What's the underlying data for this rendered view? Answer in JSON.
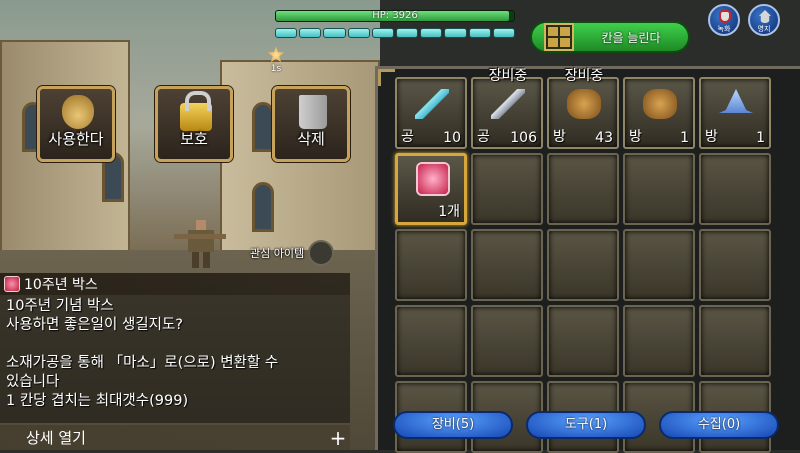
{
  "hud": {
    "hp_text": "HP: 3926",
    "hp_fraction": 0.98,
    "mp_segments": 10,
    "buff_time": "1s",
    "expand_label": "칸을 늘린다",
    "record_label": "녹화",
    "home_label": "영지"
  },
  "actions": {
    "use": "사용한다",
    "lock": "보호",
    "delete": "삭제"
  },
  "favorite_label": "관심 아이템",
  "description": {
    "title": "10주년 박스",
    "lines": [
      "10주년 기념 박스",
      "사용하면 좋은일이 생길지도?",
      "",
      "소재가공을 통해 「마소」로(으로) 변환할 수",
      "있습니다",
      " 1 칸당 겹치는 최대갯수(999)"
    ],
    "detail_label": "상세 열기",
    "detail_plus": "+"
  },
  "inventory": {
    "slots": [
      {
        "icon": "sword-icon",
        "left": "공",
        "right": "10",
        "tag": ""
      },
      {
        "icon": "greatsword-icon",
        "left": "공",
        "right": "106",
        "tag": "장비중"
      },
      {
        "icon": "armor-icon",
        "left": "방",
        "right": "43",
        "tag": "장비중"
      },
      {
        "icon": "armor-icon",
        "left": "방",
        "right": "1",
        "tag": ""
      },
      {
        "icon": "hat-icon",
        "left": "방",
        "right": "1",
        "tag": ""
      },
      {
        "icon": "gift-box-icon",
        "left": "",
        "right": "1개",
        "tag": "",
        "selected": true
      }
    ],
    "total_visible_slots": 25
  },
  "tabs": [
    {
      "label": "장비(5)"
    },
    {
      "label": "도구(1)"
    },
    {
      "label": "수집(0)"
    }
  ]
}
